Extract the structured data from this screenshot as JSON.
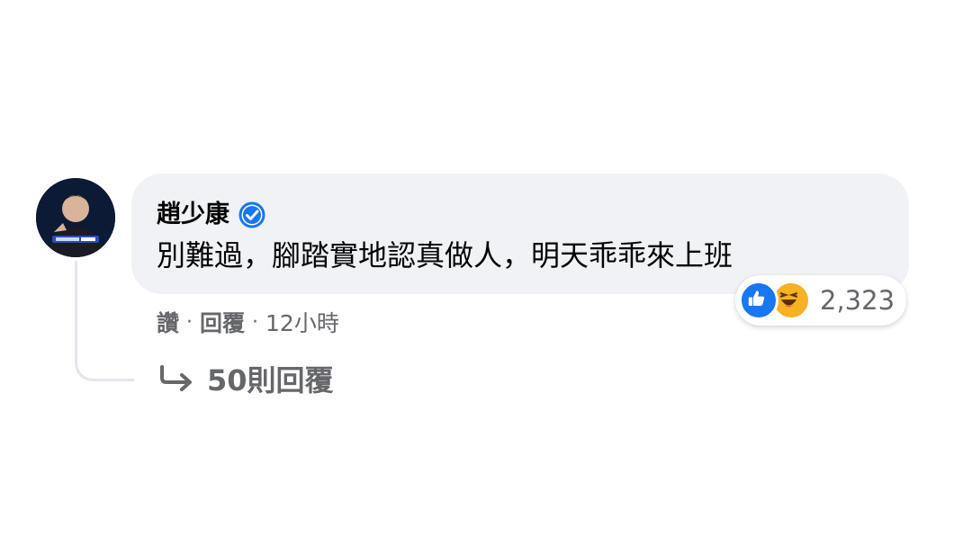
{
  "comment": {
    "author": "趙少康",
    "verified_icon": "verified-badge-icon",
    "text": "別難過，腳踏實地認真做人，明天乖乖來上班",
    "avatar_icon": "profile-photo",
    "reactions": {
      "icons": [
        "like-icon",
        "haha-icon"
      ],
      "count": "2,323",
      "colors": {
        "like": "#1877f2",
        "haha": "#f7b125"
      }
    },
    "actions": {
      "like_label": "讚",
      "separator": "·",
      "reply_label": "回覆",
      "time": "12小時"
    },
    "replies": {
      "icon": "reply-arrow-icon",
      "label": "50則回覆"
    }
  },
  "colors": {
    "bubble": "#f0f2f5",
    "secondary_text": "#65676b",
    "verified": "#1877f2"
  }
}
